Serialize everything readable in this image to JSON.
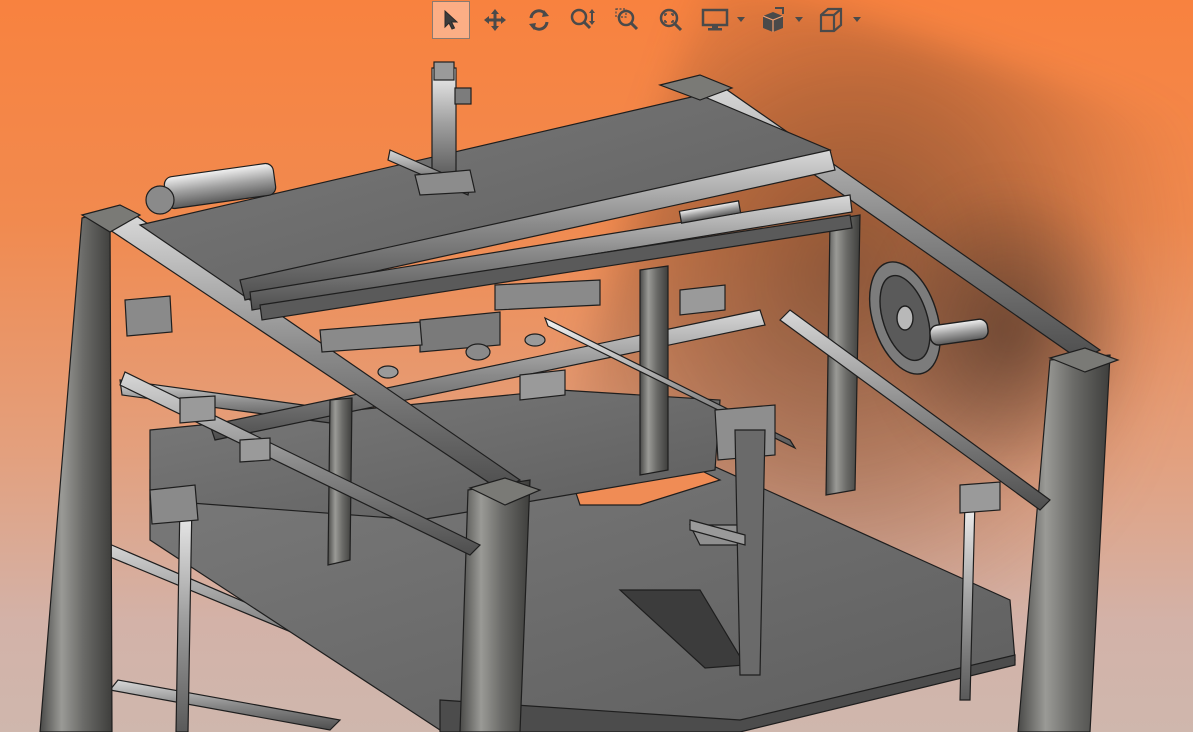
{
  "toolbar": {
    "buttons": [
      {
        "name": "select",
        "icon": "arrow-pointer-icon",
        "active": true
      },
      {
        "name": "pan",
        "icon": "pan-move-icon",
        "active": false
      },
      {
        "name": "rotate",
        "icon": "rotate-icon",
        "active": false
      },
      {
        "name": "zoom-in-out",
        "icon": "zoom-in-out-icon",
        "active": false
      },
      {
        "name": "zoom-area",
        "icon": "zoom-area-icon",
        "active": false
      },
      {
        "name": "fit-all",
        "icon": "fit-all-icon",
        "active": false
      },
      {
        "name": "display-mode",
        "icon": "monitor-icon",
        "has_dropdown": true
      },
      {
        "name": "view-mode",
        "icon": "view-cube-edit-icon",
        "has_dropdown": true
      },
      {
        "name": "standard-views",
        "icon": "iso-view-cube-icon",
        "has_dropdown": true
      }
    ],
    "icon_color": "#4a4a4a",
    "active_border": "#8a7a70"
  },
  "viewport": {
    "background_top": "#f8823f",
    "background_bottom": "#cfb7ad",
    "model_fill": "#6e6e6e",
    "model_light": "#b9b9b9",
    "model_edge": "#1e1e1e"
  }
}
